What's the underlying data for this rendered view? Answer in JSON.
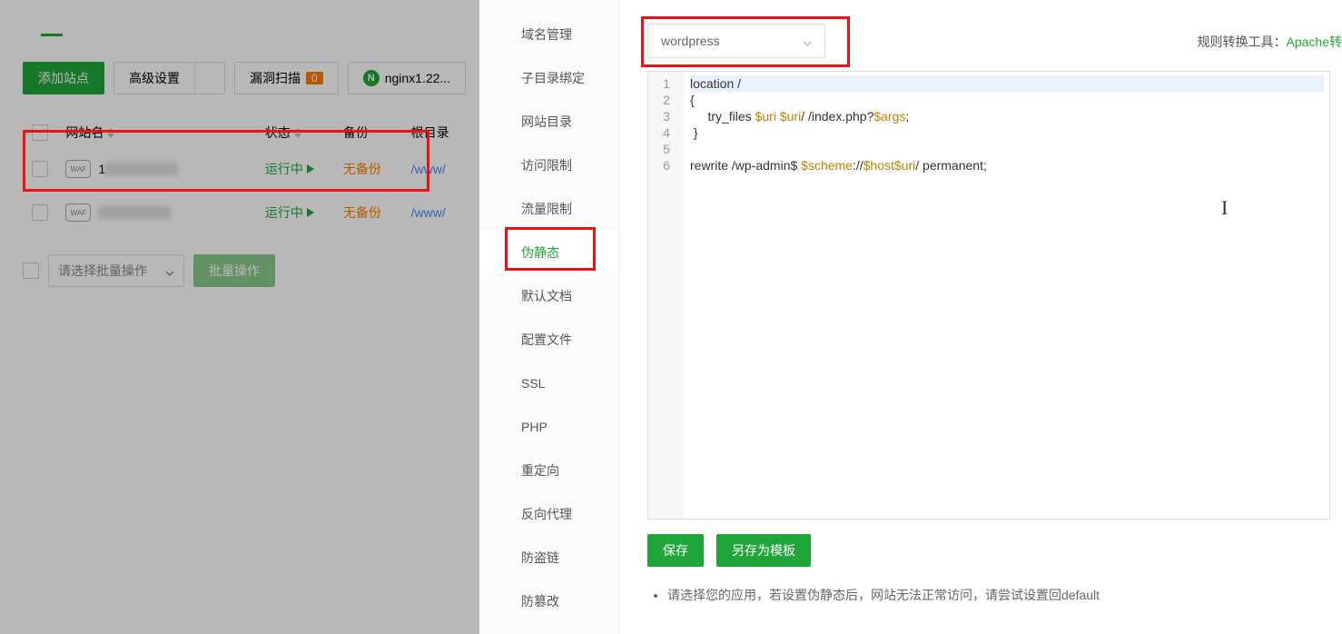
{
  "toolbar": {
    "add_site": "添加站点",
    "advanced": "高级设置",
    "vuln_scan": "漏洞扫描",
    "vuln_count": "0",
    "nginx": "nginx1.22...",
    "nginx_icon_label": "N"
  },
  "table": {
    "headers": {
      "name": "网站名",
      "status": "状态",
      "backup": "备份",
      "root": "根目录"
    },
    "rows": [
      {
        "name": "1",
        "status": "运行中",
        "backup": "无备份",
        "root": "/www/"
      },
      {
        "name": "",
        "status": "运行中",
        "backup": "无备份",
        "root": "/www/"
      }
    ]
  },
  "batch": {
    "placeholder": "请选择批量操作",
    "button": "批量操作"
  },
  "side_menu": [
    "域名管理",
    "子目录绑定",
    "网站目录",
    "访问限制",
    "流量限制",
    "伪静态",
    "默认文档",
    "配置文件",
    "SSL",
    "PHP",
    "重定向",
    "反向代理",
    "防盗链",
    "防篡改"
  ],
  "side_menu_active": 5,
  "template_select": "wordpress",
  "convert": {
    "label": "规则转换工具：",
    "link": "Apache转"
  },
  "code": {
    "lines": [
      "location /",
      "{",
      "     try_files $uri $uri/ /index.php?$args;",
      " }",
      "",
      "rewrite /wp-admin$ $scheme://$host$uri/ permanent;"
    ]
  },
  "buttons": {
    "save": "保存",
    "save_as": "另存为模板"
  },
  "tips": [
    "请选择您的应用，若设置伪静态后，网站无法正常访问，请尝试设置回default"
  ]
}
